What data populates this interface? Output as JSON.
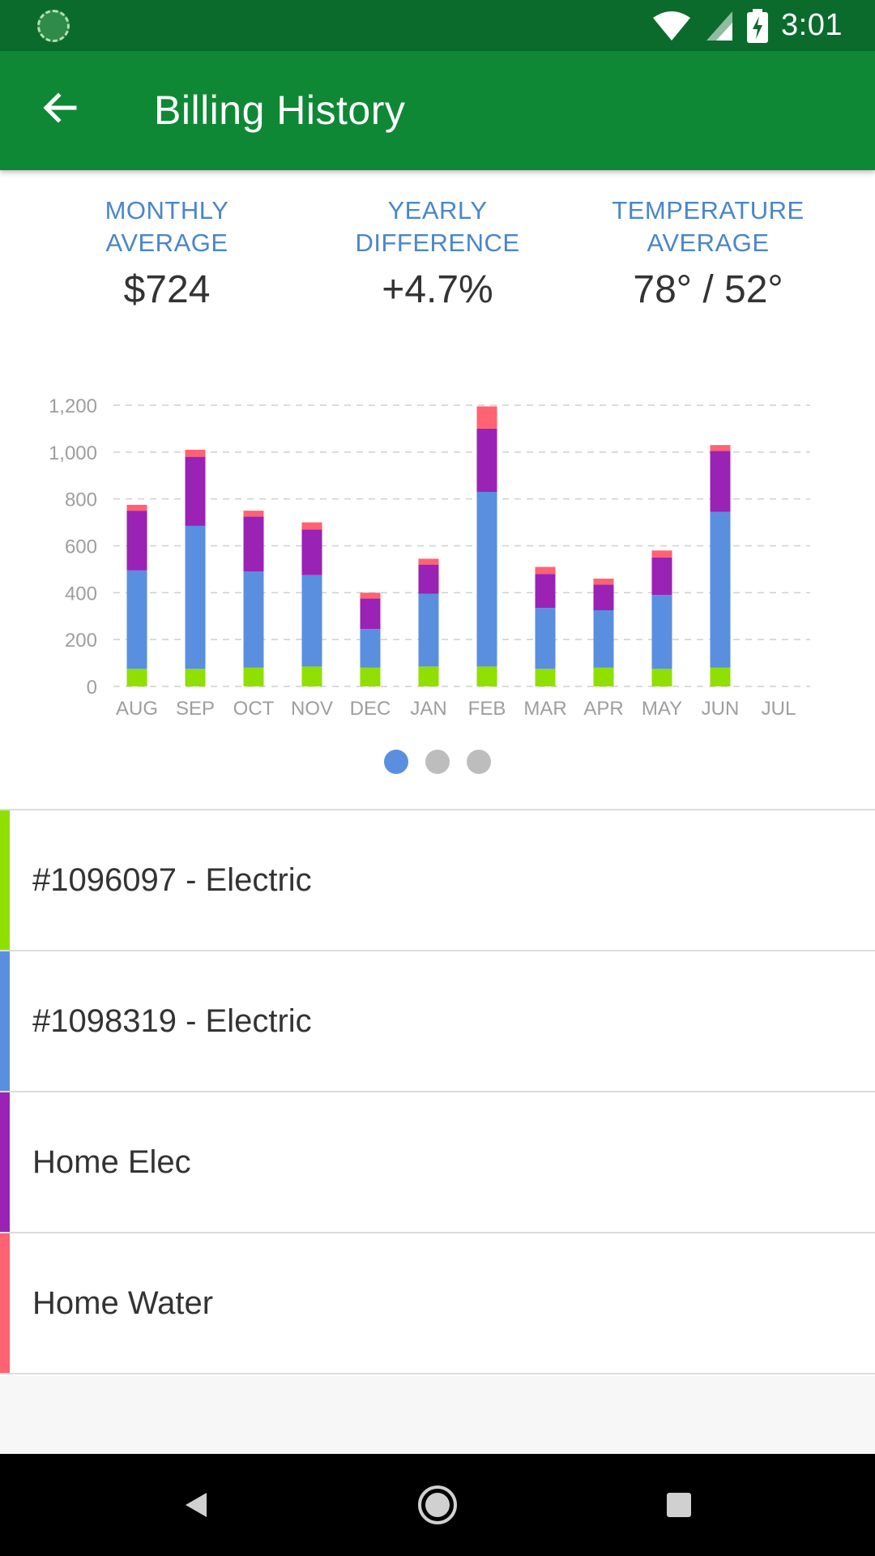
{
  "status_bar": {
    "time": "3:01",
    "icons": [
      "app-notification-icon",
      "wifi-icon",
      "signal-icon",
      "battery-charging-icon"
    ]
  },
  "app_bar": {
    "title": "Billing History",
    "back_icon": "arrow-back-icon"
  },
  "stats": [
    {
      "label": "MONTHLY\nAVERAGE",
      "value": "$724"
    },
    {
      "label": "YEARLY\nDIFFERENCE",
      "value": "+4.7%"
    },
    {
      "label": "TEMPERATURE\nAVERAGE",
      "value": "78° / 52°"
    }
  ],
  "chart_data": {
    "type": "bar",
    "stacked": true,
    "categories": [
      "AUG",
      "SEP",
      "OCT",
      "NOV",
      "DEC",
      "JAN",
      "FEB",
      "MAR",
      "APR",
      "MAY",
      "JUN",
      "JUL"
    ],
    "ylim": [
      0,
      1200
    ],
    "yticks": [
      0,
      200,
      400,
      600,
      800,
      1000,
      1200
    ],
    "ytick_labels": [
      "0",
      "200",
      "400",
      "600",
      "800",
      "1,000",
      "1,200"
    ],
    "grid": true,
    "series": [
      {
        "color": "#8fe000",
        "values": [
          75,
          75,
          80,
          85,
          80,
          85,
          85,
          75,
          80,
          75,
          80,
          0
        ]
      },
      {
        "color": "#5a8fe0",
        "values": [
          420,
          610,
          410,
          390,
          165,
          310,
          745,
          260,
          245,
          315,
          665,
          0
        ]
      },
      {
        "color": "#9a22b5",
        "values": [
          255,
          295,
          235,
          195,
          130,
          125,
          270,
          145,
          110,
          160,
          260,
          0
        ]
      },
      {
        "color": "#ff6272",
        "values": [
          25,
          30,
          25,
          30,
          25,
          25,
          95,
          30,
          25,
          30,
          25,
          0
        ]
      }
    ]
  },
  "pager": {
    "count": 3,
    "active": 0
  },
  "accounts": [
    {
      "label": "#1096097 - Electric",
      "color": "#8fe000"
    },
    {
      "label": "#1098319 - Electric",
      "color": "#5a8fe0"
    },
    {
      "label": "Home Elec",
      "color": "#9a22b5"
    },
    {
      "label": "Home Water",
      "color": "#ff6272"
    }
  ],
  "nav_bar": {
    "icons": [
      "back-triangle-icon",
      "home-circle-icon",
      "recents-square-icon"
    ]
  }
}
